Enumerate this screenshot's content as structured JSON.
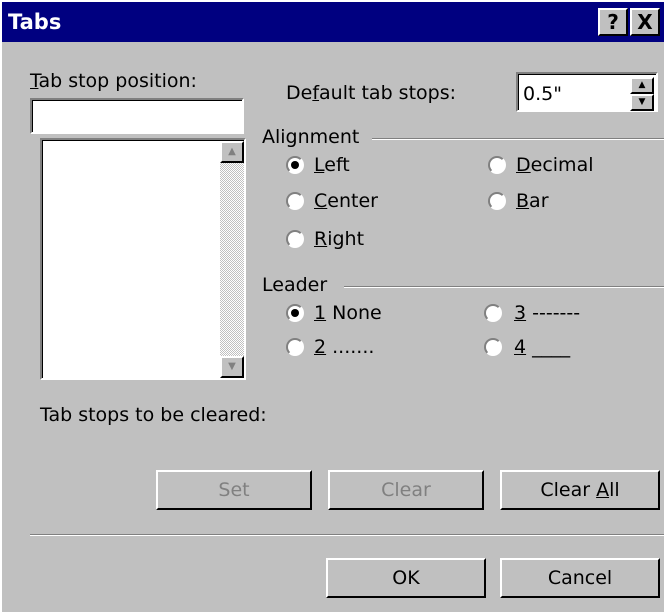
{
  "dialog": {
    "title": "Tabs",
    "help_btn": "?",
    "close_btn": "X"
  },
  "tab_stop": {
    "label_u": "T",
    "label_rest": "ab stop position:",
    "value": ""
  },
  "default_tabs": {
    "label_pre": "De",
    "label_u": "f",
    "label_post": "ault tab stops:",
    "value": "0.5\""
  },
  "alignment": {
    "group_label": "Alignment",
    "options": [
      {
        "u": "L",
        "rest": "eft",
        "selected": true
      },
      {
        "u": "C",
        "rest": "enter",
        "selected": false
      },
      {
        "u": "R",
        "rest": "ight",
        "selected": false
      },
      {
        "u": "D",
        "rest": "ecimal",
        "selected": false
      },
      {
        "u": "B",
        "rest": "ar",
        "selected": false
      }
    ]
  },
  "leader": {
    "group_label": "Leader",
    "options": [
      {
        "u": "1",
        "rest": " None",
        "selected": true
      },
      {
        "u": "2",
        "rest": " .......",
        "selected": false
      },
      {
        "u": "3",
        "rest": " -------",
        "selected": false
      },
      {
        "u": "4",
        "rest": " ____",
        "selected": false
      }
    ]
  },
  "cleared_label": "Tab stops to be cleared:",
  "buttons": {
    "set": "Set",
    "clear": "Clear",
    "clear_all_pre": "Clear ",
    "clear_all_u": "A",
    "clear_all_post": "ll",
    "ok": "OK",
    "cancel": "Cancel"
  },
  "icons": {
    "help": "help-icon",
    "close": "close-icon",
    "scroll_up": "arrow-up-icon",
    "scroll_down": "arrow-down-icon",
    "spin_up": "spin-up-icon",
    "spin_down": "spin-down-icon"
  }
}
